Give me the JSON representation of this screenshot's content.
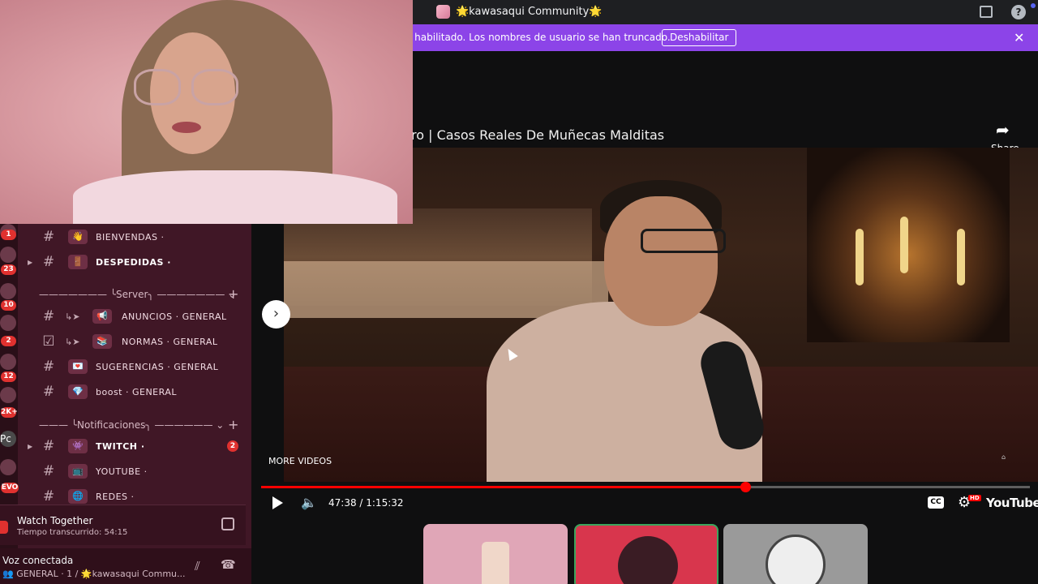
{
  "titlebar": {
    "title": "🌟kawasaqui Community🌟"
  },
  "banner": {
    "message": "á habilitado. Los nombres de usuario se han truncado.",
    "button": "Deshabilitar",
    "close": "✕"
  },
  "video": {
    "title": "ro | Casos Reales De Muñecas Malditas",
    "share": "Share",
    "more_videos": "MORE VIDEOS",
    "time": "47:38 / 1:15:32",
    "progress": 0.63,
    "youtube": "YouTube"
  },
  "sidebar": {
    "rail_badges": [
      "1",
      "23",
      "10",
      "2",
      "12",
      "2K+",
      "Pc",
      "EVO"
    ],
    "categories": [
      {
        "label": "——————— ╰Server╮ ——————— ⌄"
      },
      {
        "label": "——— ╰Notificaciones╮ —————— ⌄"
      }
    ],
    "channels": [
      {
        "emoji": "👋",
        "name": "BIENVENDAS ·"
      },
      {
        "emoji": "🚪",
        "name": "DESPEDIDAS ·"
      },
      {
        "emoji": "📢",
        "name": "ANUNCIOS · GENERAL"
      },
      {
        "emoji": "📚",
        "name": "NORMAS · GENERAL"
      },
      {
        "emoji": "💌",
        "name": "SUGERENCIAS · GENERAL"
      },
      {
        "emoji": "💎",
        "name": "boost · GENERAL"
      },
      {
        "emoji": "👾",
        "name": "TWITCH ·",
        "unread": "2"
      },
      {
        "emoji": "📺",
        "name": "YOUTUBE ·"
      },
      {
        "emoji": "🌐",
        "name": "REDES ·"
      }
    ],
    "activity": {
      "title": "Watch Together",
      "subtitle": "Tiempo transcurrido: 54:15"
    },
    "voice": {
      "status": "Voz conectada",
      "channel": "👥 GENERAL · 1 / 🌟kawasaqui Commu..."
    }
  },
  "colors": {
    "accent": "#8c44e8",
    "sidebar": "#401726",
    "progress": "#ff0000"
  }
}
